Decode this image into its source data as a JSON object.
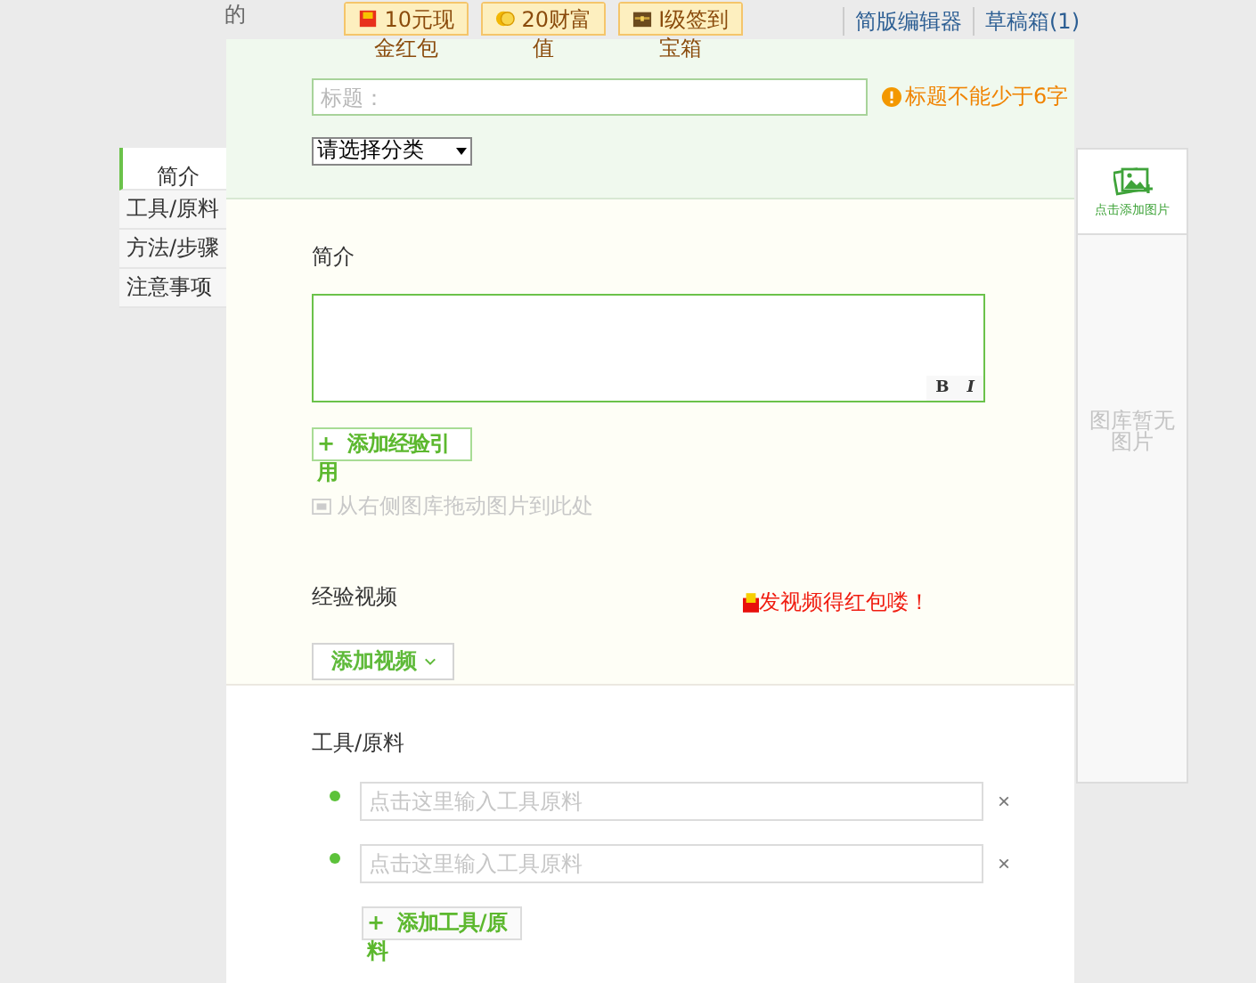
{
  "header": {
    "partial_text": "的",
    "badges": [
      {
        "kind": "envelope",
        "label": "10元现金红包"
      },
      {
        "kind": "coin",
        "label": "20财富值"
      },
      {
        "kind": "chest",
        "label": "I级签到宝箱"
      }
    ],
    "links": [
      "简版编辑器",
      "草稿箱(1)"
    ]
  },
  "nav": {
    "items": [
      {
        "label": "简介",
        "selected": true
      },
      {
        "label": "工具/原料",
        "selected": false
      },
      {
        "label": "方法/步骤",
        "selected": false
      },
      {
        "label": "注意事项",
        "selected": false
      }
    ]
  },
  "title_field": {
    "placeholder": "标题：",
    "warning": "标题不能少于6字"
  },
  "category_select": {
    "value": "请选择分类"
  },
  "intro": {
    "label": "简介",
    "format_buttons": [
      "B",
      "I"
    ],
    "add_button": "+  添加经验引用",
    "drag_hint": "从右侧图库拖动图片到此处"
  },
  "video": {
    "label": "经验视频",
    "promo": "发视频得红包喽！",
    "add_button": "添加视频"
  },
  "tools": {
    "label": "工具/原料",
    "rows": [
      {
        "placeholder": "点击这里输入工具原料",
        "remove": "×"
      },
      {
        "placeholder": "点击这里输入工具原料",
        "remove": "×"
      }
    ],
    "add_button": "+  添加工具/原料"
  },
  "gallery": {
    "add_label": "点击添加图片",
    "empty_text": "图库暂无图片"
  }
}
